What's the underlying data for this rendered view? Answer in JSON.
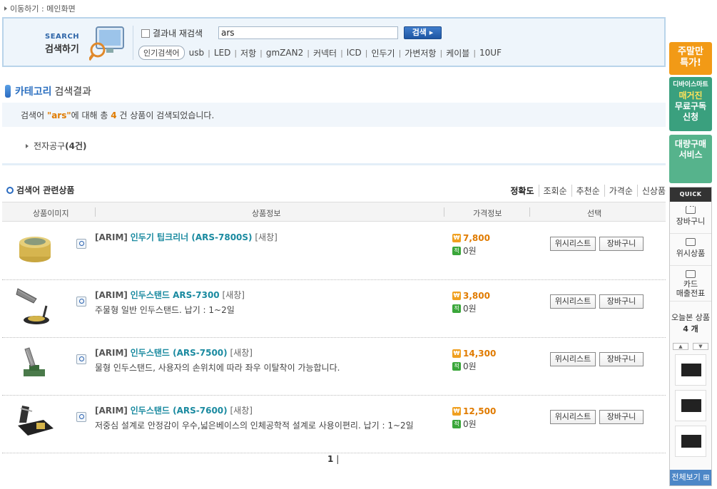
{
  "breadcrumb": {
    "label": "이동하기",
    "sep": ":",
    "current": "메인화면"
  },
  "search": {
    "logo_en": "SEARCH",
    "logo_ko": "검색하기",
    "re_search_label": "결과내 재검색",
    "query": "ars",
    "button_label": "검색",
    "popular_tag": "인기검색어",
    "popular_keywords": [
      "usb",
      "LED",
      "저항",
      "gmZAN2",
      "커넥터",
      "lCD",
      "인두기",
      "가변저항",
      "케이블",
      "10UF"
    ]
  },
  "category": {
    "title_blue": "카테고리",
    "title_rest": "검색결과",
    "result_prefix": "검색어 ",
    "result_keyword": "\"ars\"",
    "result_mid": "에 대해 총 ",
    "result_count": "4",
    "result_suffix": " 건 상품이 검색되었습니다.",
    "item_name": "전자공구",
    "item_count": "(4건)"
  },
  "products": {
    "title": "검색어 관련상품",
    "sort_options": [
      "정확도",
      "조회순",
      "추천순",
      "가격순",
      "신상품"
    ],
    "columns": [
      "상품이미지",
      "상품정보",
      "가격정보",
      "선택"
    ],
    "wish_label": "위시리스트",
    "cart_label": "장바구니",
    "rows": [
      {
        "brand": "[ARIM]",
        "name": "인두기 팁크리너 (ARS-7800S)",
        "status": "[새창]",
        "desc": "",
        "price": "7,800",
        "points": "0원"
      },
      {
        "brand": "[ARIM]",
        "name": "인두스탠드 ARS-7300",
        "status": "[새창]",
        "desc": "주물형 일반 인두스탠드. 납기 : 1~2일",
        "price": "3,800",
        "points": "0원"
      },
      {
        "brand": "[ARIM]",
        "name": "인두스탠드 (ARS-7500)",
        "status": "[새창]",
        "desc": "물형 인두스탠드, 사용자의 손위치에 따라 좌우 이탈착이 가능합니다.",
        "price": "14,300",
        "points": "0원"
      },
      {
        "brand": "[ARIM]",
        "name": "인두스탠드 (ARS-7600)",
        "status": "[새창]",
        "desc": "저중심 설계로 안정감이 우수,넓은베이스의 인체공학적 설계로 사용이편리. 납기 : 1~2일",
        "price": "12,500",
        "points": "0원"
      }
    ],
    "page": "1"
  },
  "sidebar": {
    "promo1": [
      "주말만",
      "특가!"
    ],
    "promo2_small": "디바이스마트",
    "promo2": [
      "매거진",
      "무료구독",
      "신청"
    ],
    "promo3": [
      "대량구매",
      "서비스"
    ],
    "quick_menu": "QUICK MENU",
    "quick_items": [
      "장바구니",
      "위시상품",
      "카드\n매출전표"
    ],
    "today_label": "오늘본 상품",
    "today_count": "4 개",
    "view_all": "전체보기"
  },
  "colors": {
    "accent": "#2b6fc0",
    "price": "#e07b00",
    "product_name": "#1a8aa0"
  }
}
